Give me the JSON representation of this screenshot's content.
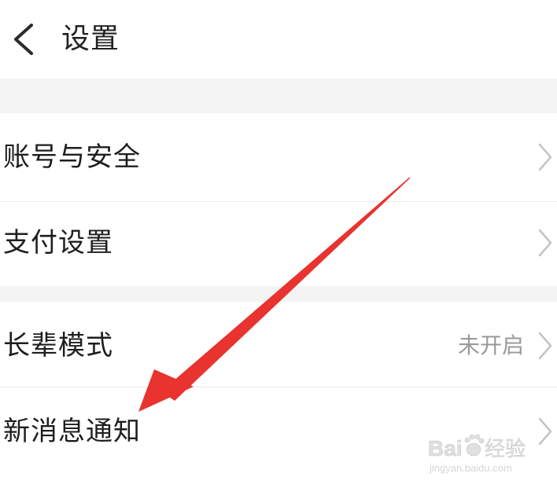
{
  "header": {
    "back_icon": "chevron-left-icon",
    "title": "设置"
  },
  "rows": [
    {
      "label": "账号与安全",
      "value": "",
      "icon": "chevron-right-icon"
    },
    {
      "label": "支付设置",
      "value": "",
      "icon": "chevron-right-icon"
    },
    {
      "label": "长辈模式",
      "value": "未开启",
      "icon": "chevron-right-icon"
    },
    {
      "label": "新消息通知",
      "value": "",
      "icon": "chevron-right-icon"
    }
  ],
  "annotation": {
    "type": "arrow",
    "color": "#e8332e"
  },
  "watermark": {
    "logo_text": "Bai经验",
    "url": "jingyan.baidu.com"
  },
  "colors": {
    "background": "#ffffff",
    "separator": "#f4f4f4",
    "text_primary": "#1e1e1e",
    "text_secondary": "#9a9a9a",
    "chevron": "#c4c4c4"
  }
}
